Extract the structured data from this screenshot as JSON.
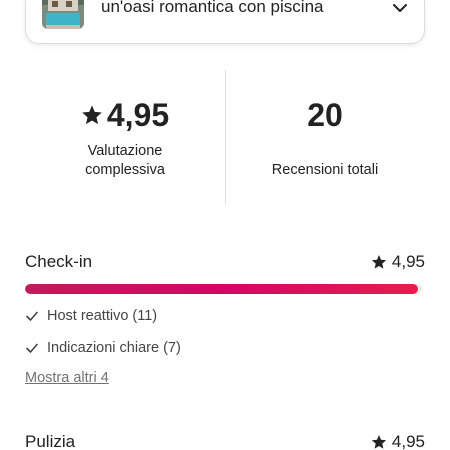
{
  "listing": {
    "title": "un'oasi romantica con piscina",
    "thumbnail": "pool-villa-photo"
  },
  "summary": {
    "overall_rating": "4,95",
    "overall_label": "Valutazione complessiva",
    "review_count": "20",
    "review_count_label": "Recensioni totali"
  },
  "categories": [
    {
      "name": "Check-in",
      "rating": "4,95",
      "rating_fraction": 0.99,
      "highlights": [
        "Host reattivo (11)",
        "Indicazioni chiare (7)"
      ],
      "show_more": "Mostra altri 4"
    },
    {
      "name": "Pulizia",
      "rating": "4,95"
    }
  ],
  "colors": {
    "accent_gradient": [
      "#bd1e59",
      "#d70466",
      "#e61e4d"
    ],
    "text": "#222222",
    "muted": "#717171"
  },
  "icons": [
    "star-icon",
    "check-icon",
    "chevron-down-icon"
  ]
}
